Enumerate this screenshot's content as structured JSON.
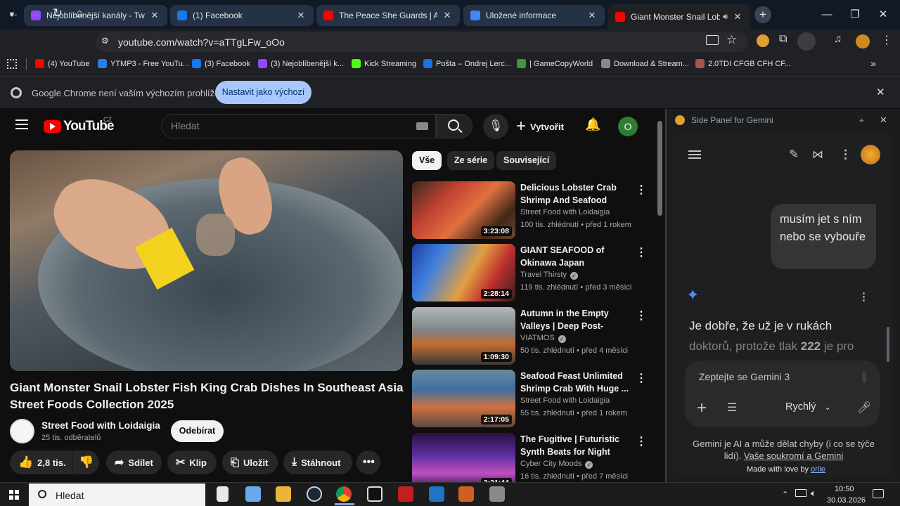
{
  "tabs": [
    {
      "title": "Nejoblíbenější kanály - Twitch",
      "icon": "twitch-icon",
      "color": "#9146ff"
    },
    {
      "title": "(1) Facebook",
      "icon": "facebook-icon",
      "color": "#1877f2"
    },
    {
      "title": "The Peace She Guards | Ambien",
      "icon": "youtube-icon",
      "color": "#ff0000"
    },
    {
      "title": "Uložené informace",
      "icon": "google-icon",
      "color": "#4285f4"
    },
    {
      "title": "Giant Monster Snail Lobster",
      "icon": "youtube-icon",
      "color": "#ff0000"
    }
  ],
  "address": {
    "url": "youtube.com/watch?v=aTTgLFw_oOo"
  },
  "bookmarks": [
    {
      "label": "(4) YouTube",
      "color": "#ff0000"
    },
    {
      "label": "YTMP3 - Free YouTu...",
      "color": "#2b7de9"
    },
    {
      "label": "(3) Facebook",
      "color": "#1877f2"
    },
    {
      "label": "(3) Nejoblíbenější k...",
      "color": "#9146ff"
    },
    {
      "label": "Kick Streaming",
      "color": "#53fc18"
    },
    {
      "label": "Pošta – Ondrej Lerc...",
      "color": "#1a73e8"
    },
    {
      "label": "| GameCopyWorld",
      "color": "#3a9a3a"
    },
    {
      "label": "Download & Stream...",
      "color": "#888888"
    },
    {
      "label": "2.0TDI CFGB CFH CF...",
      "color": "#b05050"
    }
  ],
  "infobar": {
    "text": "Google Chrome není vaším výchozím prohlížečem",
    "button": "Nastavit jako výchozí"
  },
  "youtube": {
    "logo": "YouTube",
    "country": "CZ",
    "search_placeholder": "Hledat",
    "create": "Vytvořit",
    "avatar": "O",
    "video_title": "Giant Monster Snail Lobster Fish King Crab Dishes In Southeast Asia Street Foods Collection 2025",
    "channel": "Street Food with Loidaigia",
    "subscribers": "25 tis. odběratelů",
    "subscribe": "Odebírat",
    "likes": "2,8 tis.",
    "share": "Sdílet",
    "clip": "Klip",
    "save": "Uložit",
    "download": "Stáhnout",
    "chips": [
      "Vše",
      "Ze série",
      "Související"
    ]
  },
  "recommendations": [
    {
      "title": "Delicious Lobster Crab Shrimp And Seafood Dishe...",
      "channel": "Street Food with Loidaigia",
      "verified": false,
      "meta": "100 tis. zhlédnutí • před 1 rokem",
      "duration": "3:23:08"
    },
    {
      "title": "GIANT SEAFOOD of Okinawa Japan",
      "channel": "Travel Thirsty",
      "verified": true,
      "meta": "119 tis. zhlédnutí • před 3 měsíci",
      "duration": "2:28:14"
    },
    {
      "title": "Autumn in the Empty Valleys | Deep Post-Apocalyptic ...",
      "channel": "VIATMOS",
      "verified": true,
      "meta": "50 tis. zhlédnutí • před 4 měsíci",
      "duration": "1:09:30"
    },
    {
      "title": "Seafood Feast Unlimited Shrimp Crab With Huge ...",
      "channel": "Street Food with Loidaigia",
      "verified": false,
      "meta": "55 tis. zhlédnutí • před 1 rokem",
      "duration": "2:17:05"
    },
    {
      "title": "The Fugitive | Futuristic Synth Beats for Night Drive...",
      "channel": "Cyber City Moods",
      "verified": true,
      "meta": "16 tis. zhlédnutí • před 7 měsíci",
      "duration": "3:21:44"
    }
  ],
  "gemini": {
    "panel_title": "Side Panel for Gemini",
    "user_message": "musím jet s ním nebo se vybouře",
    "response_line1": "Je dobře, že už je v rukách",
    "response_line2_pre": "doktorů, protože tlak ",
    "response_line2_bold": "222",
    "response_line2_post": " je pro",
    "input_placeholder": "Zeptejte se Gemini 3",
    "mode": "Rychlý",
    "disclaimer": "Gemini je AI a může dělat chyby (i co se týče lidí).",
    "privacy_link": "Vaše soukromí a Gemini",
    "made_with": "Made with love by",
    "made_by": "orlie"
  },
  "taskbar": {
    "search": "Hledat",
    "time": "10:50",
    "date": "30.03.2026"
  }
}
